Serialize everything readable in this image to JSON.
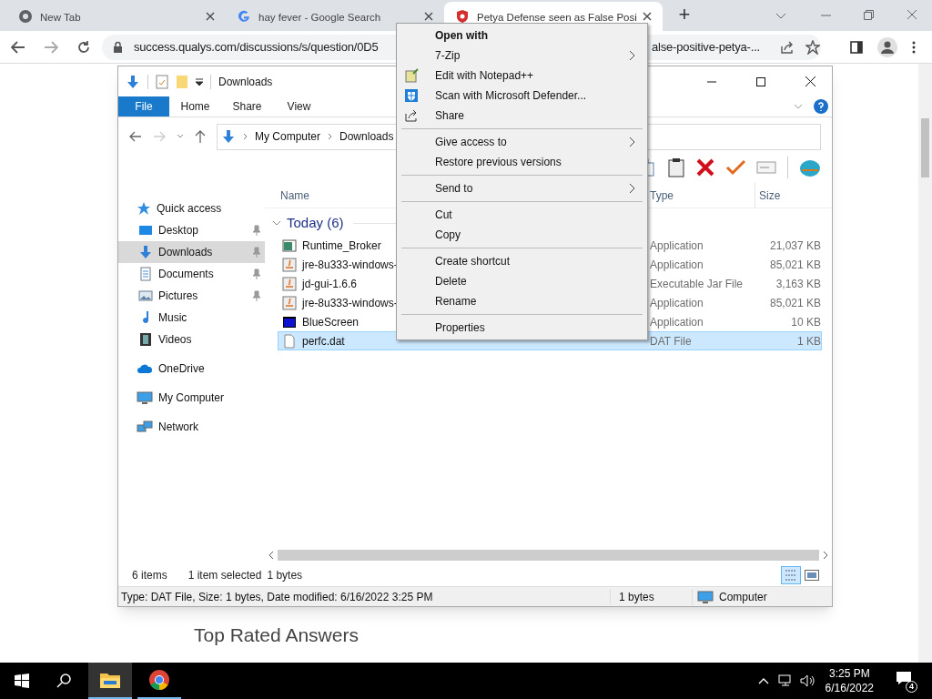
{
  "browser": {
    "tabs": [
      {
        "title": "New Tab",
        "selected": false
      },
      {
        "title": "hay fever - Google Search",
        "selected": false
      },
      {
        "title": "Petya Defense seen as False Posi",
        "selected": true
      }
    ],
    "new_tab": "+",
    "url_start": "success.qualys.com/discussions/s/question/0D5",
    "url_end": "alse-positive-petya-..."
  },
  "page": {
    "heading": "Top Rated Answers"
  },
  "explorer": {
    "title": "Downloads",
    "ribbon_tabs": [
      {
        "label": "File",
        "selected": true
      },
      {
        "label": "Home",
        "selected": false
      },
      {
        "label": "Share",
        "selected": false
      },
      {
        "label": "View",
        "selected": false
      }
    ],
    "breadcrumb": [
      "My Computer",
      "Downloads"
    ],
    "nav": [
      {
        "label": "Quick access",
        "selected": false,
        "children": [
          {
            "label": "Desktop",
            "selected": false,
            "pinned": true
          },
          {
            "label": "Downloads",
            "selected": true,
            "pinned": true
          },
          {
            "label": "Documents",
            "selected": false,
            "pinned": true
          },
          {
            "label": "Pictures",
            "selected": false,
            "pinned": true
          },
          {
            "label": "Music",
            "selected": false,
            "pinned": false
          },
          {
            "label": "Videos",
            "selected": false,
            "pinned": false
          }
        ]
      },
      {
        "label": "OneDrive",
        "selected": false
      },
      {
        "label": "My Computer",
        "selected": false
      },
      {
        "label": "Network",
        "selected": false
      }
    ],
    "columns": [
      {
        "label": "Name"
      },
      {
        "label": "Type"
      },
      {
        "label": "Size"
      }
    ],
    "group": {
      "label": "Today (6)",
      "expanded": true
    },
    "files": [
      {
        "name": "Runtime_Broker",
        "type": "Application",
        "size": "21,037 KB",
        "selected": false
      },
      {
        "name": "jre-8u333-windows-",
        "type": "Application",
        "size": "85,021 KB",
        "selected": false
      },
      {
        "name": "jd-gui-1.6.6",
        "type": "Executable Jar File",
        "size": "3,163 KB",
        "selected": false
      },
      {
        "name": "jre-8u333-windows-",
        "type": "Application",
        "size": "85,021 KB",
        "selected": false
      },
      {
        "name": "BlueScreen",
        "type": "Application",
        "size": "10 KB",
        "selected": false
      },
      {
        "name": "perfc.dat",
        "type": "DAT File",
        "size": "1 KB",
        "selected": true
      }
    ],
    "status": {
      "count": "6 items",
      "selection": "1 item selected",
      "selection_size": "1 bytes"
    },
    "details": {
      "text": "Type: DAT File, Size: 1 bytes, Date modified: 6/16/2022 3:25 PM",
      "size": "1 bytes",
      "location": "Computer"
    }
  },
  "context_menu": [
    {
      "kind": "header",
      "label": "Open with"
    },
    {
      "kind": "submenu",
      "label": "7-Zip"
    },
    {
      "kind": "item",
      "label": "Edit with Notepad++"
    },
    {
      "kind": "item",
      "label": "Scan with Microsoft Defender..."
    },
    {
      "kind": "item",
      "label": "Share"
    },
    {
      "kind": "separator"
    },
    {
      "kind": "submenu",
      "label": "Give access to"
    },
    {
      "kind": "item",
      "label": "Restore previous versions"
    },
    {
      "kind": "separator"
    },
    {
      "kind": "submenu",
      "label": "Send to"
    },
    {
      "kind": "separator"
    },
    {
      "kind": "item",
      "label": "Cut"
    },
    {
      "kind": "item",
      "label": "Copy"
    },
    {
      "kind": "separator"
    },
    {
      "kind": "item",
      "label": "Create shortcut"
    },
    {
      "kind": "item",
      "label": "Delete"
    },
    {
      "kind": "item",
      "label": "Rename"
    },
    {
      "kind": "separator"
    },
    {
      "kind": "item",
      "label": "Properties"
    }
  ],
  "taskbar": {
    "apps": [
      {
        "kind": "explorer",
        "selected": true
      },
      {
        "kind": "chrome",
        "selected": false
      }
    ],
    "time": "3:25 PM",
    "date": "6/16/2022",
    "notifications": "4"
  }
}
